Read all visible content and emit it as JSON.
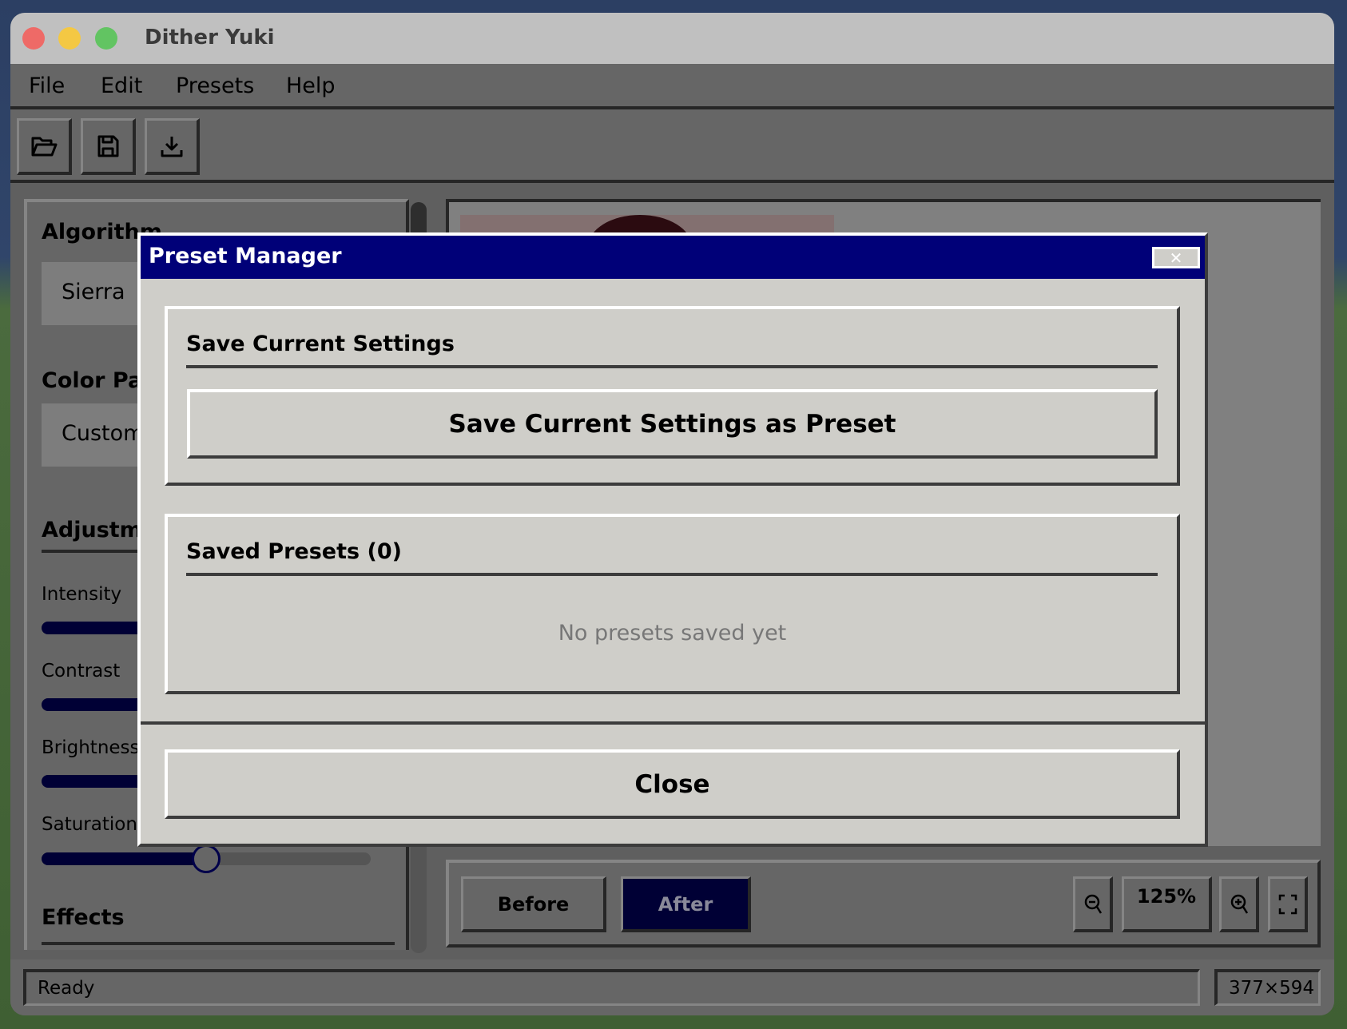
{
  "window": {
    "title": "Dither Yuki"
  },
  "menu": [
    "File",
    "Edit",
    "Presets",
    "Help"
  ],
  "toolbar": [
    {
      "icon": "folder-open-icon",
      "tooltip": ""
    },
    {
      "icon": "save-icon"
    },
    {
      "icon": "download-icon"
    }
  ],
  "left_panel": {
    "algorithm": {
      "heading": "Algorithm",
      "value": "Sierra"
    },
    "palette": {
      "heading": "Color Pal",
      "value": "Custom"
    },
    "adjustments": {
      "heading": "Adjustme",
      "sliders": [
        {
          "label": "Intensity"
        },
        {
          "label": "Contrast"
        },
        {
          "label": "Brightness"
        },
        {
          "label": "Saturation",
          "value_percent": 50
        }
      ]
    },
    "effects": {
      "heading": "Effects"
    }
  },
  "view_controls": {
    "before": "Before",
    "after": "After",
    "active": "After",
    "zoom": "125%"
  },
  "status": {
    "text": "Ready",
    "dimensions": "377×594"
  },
  "modal": {
    "title": "Preset Manager",
    "close_x": "✕",
    "save_section": {
      "heading": "Save Current Settings",
      "button": "Save Current Settings as Preset"
    },
    "saved_section": {
      "heading": "Saved Presets (0)",
      "empty": "No presets saved yet"
    },
    "close_button": "Close"
  },
  "colors": {
    "accent": "#000078",
    "active_button": "#000035",
    "dialog_bg": "#cfcec9"
  }
}
